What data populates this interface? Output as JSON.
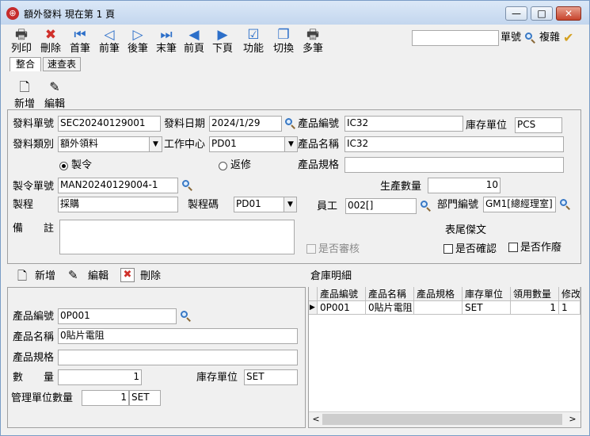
{
  "window": {
    "title": "額外發料  現在第 1 頁",
    "min": "—",
    "max": "□",
    "close": "✕"
  },
  "toolbar": {
    "items": [
      {
        "label": "列印"
      },
      {
        "label": "刪除"
      },
      {
        "label": "首筆"
      },
      {
        "label": "前筆"
      },
      {
        "label": "後筆"
      },
      {
        "label": "末筆"
      },
      {
        "label": "前頁"
      },
      {
        "label": "下頁"
      },
      {
        "label": "功能"
      },
      {
        "label": "切換"
      },
      {
        "label": "多筆"
      }
    ],
    "search_value": "",
    "search_label": "單號",
    "copy_label": "複雜"
  },
  "tabs": [
    {
      "label": "整合"
    },
    {
      "label": "速查表"
    }
  ],
  "subtoolbar": {
    "new": "新增",
    "edit": "編輯"
  },
  "header": {
    "doc_no_label": "發料單號",
    "doc_no": "SEC20240129001",
    "date_label": "發料日期",
    "date": "2024/1/29",
    "prod_no_label": "產品編號",
    "prod_no": "IC32",
    "unit_label": "庫存單位",
    "unit": "PCS",
    "type_label": "發料類別",
    "type": "額外領料",
    "wc_label": "工作中心",
    "wc": "PD01",
    "prod_name_label": "產品名稱",
    "prod_name": "IC32",
    "radio_make": "製令",
    "radio_rework": "返修",
    "prod_spec_label": "產品規格",
    "prod_spec": "",
    "mo_label": "製令單號",
    "mo": "MAN20240129004-1",
    "qty_label": "生產數量",
    "qty": "10",
    "process_label": "製程",
    "process": "採購",
    "process_code_label": "製程碼",
    "process_code": "PD01",
    "emp_label": "員工",
    "emp": "002[]",
    "dept_label": "部門編號",
    "dept": "GM1[總經理室]",
    "remark_label": "備　　註",
    "remark": "",
    "footer_label": "表尾傑文",
    "audited_label": "是否審核",
    "confirmed_label": "是否確認",
    "void_label": "是否作廢"
  },
  "detail_toolbar": {
    "new": "新增",
    "edit": "編輯",
    "delete": "刪除"
  },
  "detail_form": {
    "prod_no_label": "產品編號",
    "prod_no": "0P001",
    "prod_name_label": "產品名稱",
    "prod_name": "0貼片電阻",
    "prod_spec_label": "產品規格",
    "prod_spec": "",
    "qty_label": "數　　量",
    "qty": "1",
    "unit_label": "庫存單位",
    "unit": "SET",
    "mgmt_qty_label": "管理單位數量",
    "mgmt_qty": "1",
    "mgmt_unit": "SET"
  },
  "warehouse": {
    "title": "倉庫明細",
    "columns": [
      "產品編號",
      "產品名稱",
      "產品規格",
      "庫存單位",
      "領用數量",
      "修改"
    ],
    "rows": [
      [
        "0P001",
        "0貼片電阻",
        "",
        "SET",
        "1",
        "1"
      ]
    ],
    "scroll_left": "<",
    "scroll_right": ">"
  }
}
